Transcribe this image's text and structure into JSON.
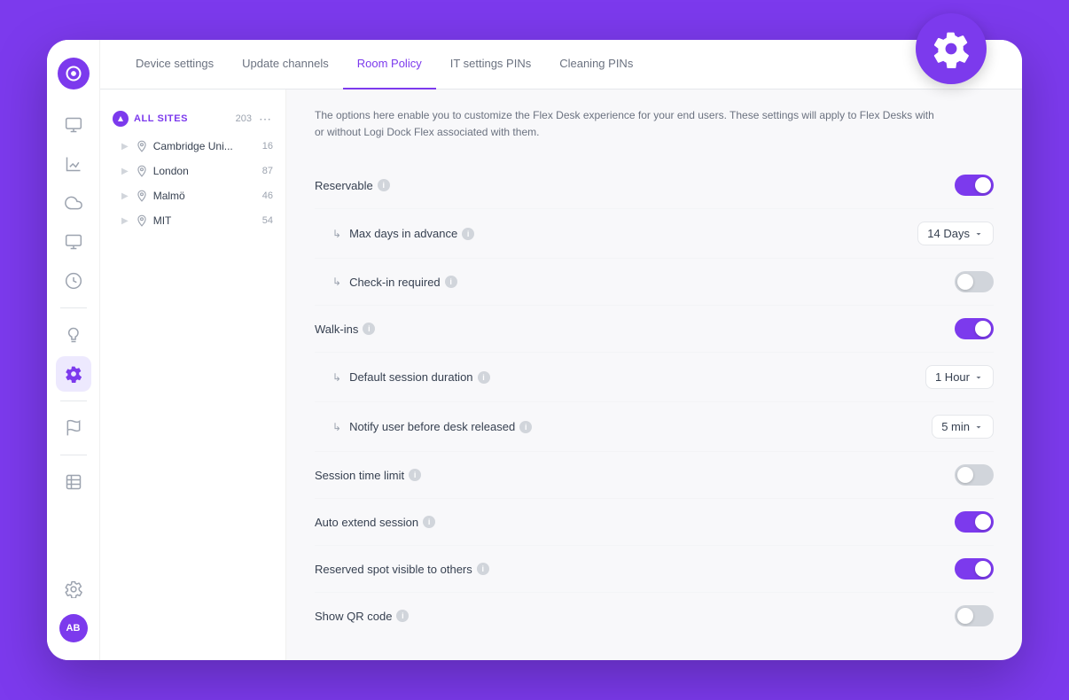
{
  "gear_badge": {
    "aria": "settings-gear"
  },
  "tabs": [
    {
      "id": "device-settings",
      "label": "Device settings",
      "active": false
    },
    {
      "id": "update-channels",
      "label": "Update channels",
      "active": false
    },
    {
      "id": "room-policy",
      "label": "Room Policy",
      "active": true
    },
    {
      "id": "it-settings-pins",
      "label": "IT settings PINs",
      "active": false
    },
    {
      "id": "cleaning-pins",
      "label": "Cleaning PINs",
      "active": false
    }
  ],
  "sites": {
    "header_label": "ALL SITES",
    "header_count": "203",
    "items": [
      {
        "name": "Cambridge Uni...",
        "count": "16"
      },
      {
        "name": "London",
        "count": "87"
      },
      {
        "name": "Malmö",
        "count": "46"
      },
      {
        "name": "MIT",
        "count": "54"
      }
    ]
  },
  "description": "The options here enable you to customize the Flex Desk experience for your end users. These settings will apply to Flex Desks with or without Logi Dock Flex associated with them.",
  "settings": [
    {
      "id": "reservable",
      "label": "Reservable",
      "indent": false,
      "control": "toggle",
      "value": "on"
    },
    {
      "id": "max-days-advance",
      "label": "Max days in advance",
      "indent": true,
      "control": "select",
      "value": "14 Days"
    },
    {
      "id": "check-in-required",
      "label": "Check-in required",
      "indent": true,
      "control": "toggle",
      "value": "off"
    },
    {
      "id": "walk-ins",
      "label": "Walk-ins",
      "indent": false,
      "control": "toggle",
      "value": "on"
    },
    {
      "id": "default-session-duration",
      "label": "Default session duration",
      "indent": true,
      "control": "select",
      "value": "1 Hour"
    },
    {
      "id": "notify-user-before",
      "label": "Notify user before desk released",
      "indent": true,
      "control": "select",
      "value": "5 min"
    },
    {
      "id": "session-time-limit",
      "label": "Session time limit",
      "indent": false,
      "control": "toggle",
      "value": "off"
    },
    {
      "id": "auto-extend-session",
      "label": "Auto extend session",
      "indent": false,
      "control": "toggle",
      "value": "on"
    },
    {
      "id": "reserved-spot-visible",
      "label": "Reserved spot visible to others",
      "indent": false,
      "control": "toggle",
      "value": "on"
    },
    {
      "id": "show-qr-code",
      "label": "Show QR code",
      "indent": false,
      "control": "toggle",
      "value": "off"
    }
  ],
  "icons": {
    "chevron_down": "▾",
    "info": "i",
    "indent_arrow": "↳"
  }
}
